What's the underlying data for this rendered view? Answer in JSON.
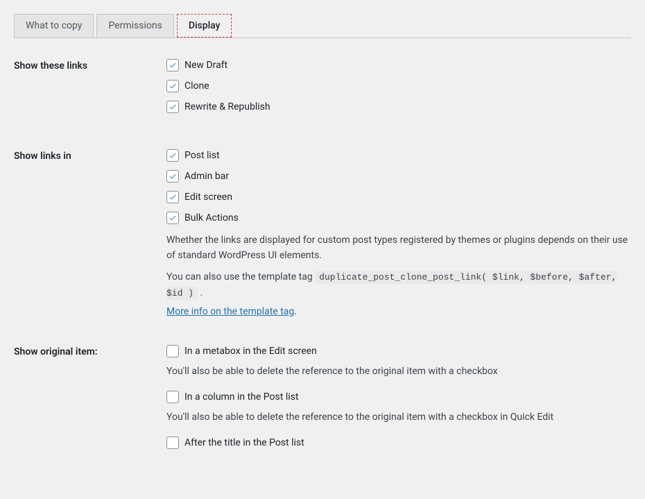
{
  "tabs": {
    "what_to_copy": "What to copy",
    "permissions": "Permissions",
    "display": "Display"
  },
  "sections": {
    "show_links": {
      "label": "Show these links",
      "options": {
        "new_draft": "New Draft",
        "clone": "Clone",
        "rewrite_republish": "Rewrite & Republish"
      }
    },
    "show_links_in": {
      "label": "Show links in",
      "options": {
        "post_list": "Post list",
        "admin_bar": "Admin bar",
        "edit_screen": "Edit screen",
        "bulk_actions": "Bulk Actions"
      },
      "desc1": "Whether the links are displayed for custom post types registered by themes or plugins depends on their use of standard WordPress UI elements.",
      "desc2_prefix": "You can also use the template tag ",
      "desc2_code": "duplicate_post_clone_post_link( $link, $before, $after, $id )",
      "desc2_suffix": " .",
      "link_text": "More info on the template tag"
    },
    "show_original": {
      "label": "Show original item:",
      "options": {
        "metabox": "In a metabox in the Edit screen",
        "metabox_desc": "You'll also be able to delete the reference to the original item with a checkbox",
        "column": "In a column in the Post list",
        "column_desc": "You'll also be able to delete the reference to the original item with a checkbox in Quick Edit",
        "after_title": "After the title in the Post list"
      }
    }
  }
}
